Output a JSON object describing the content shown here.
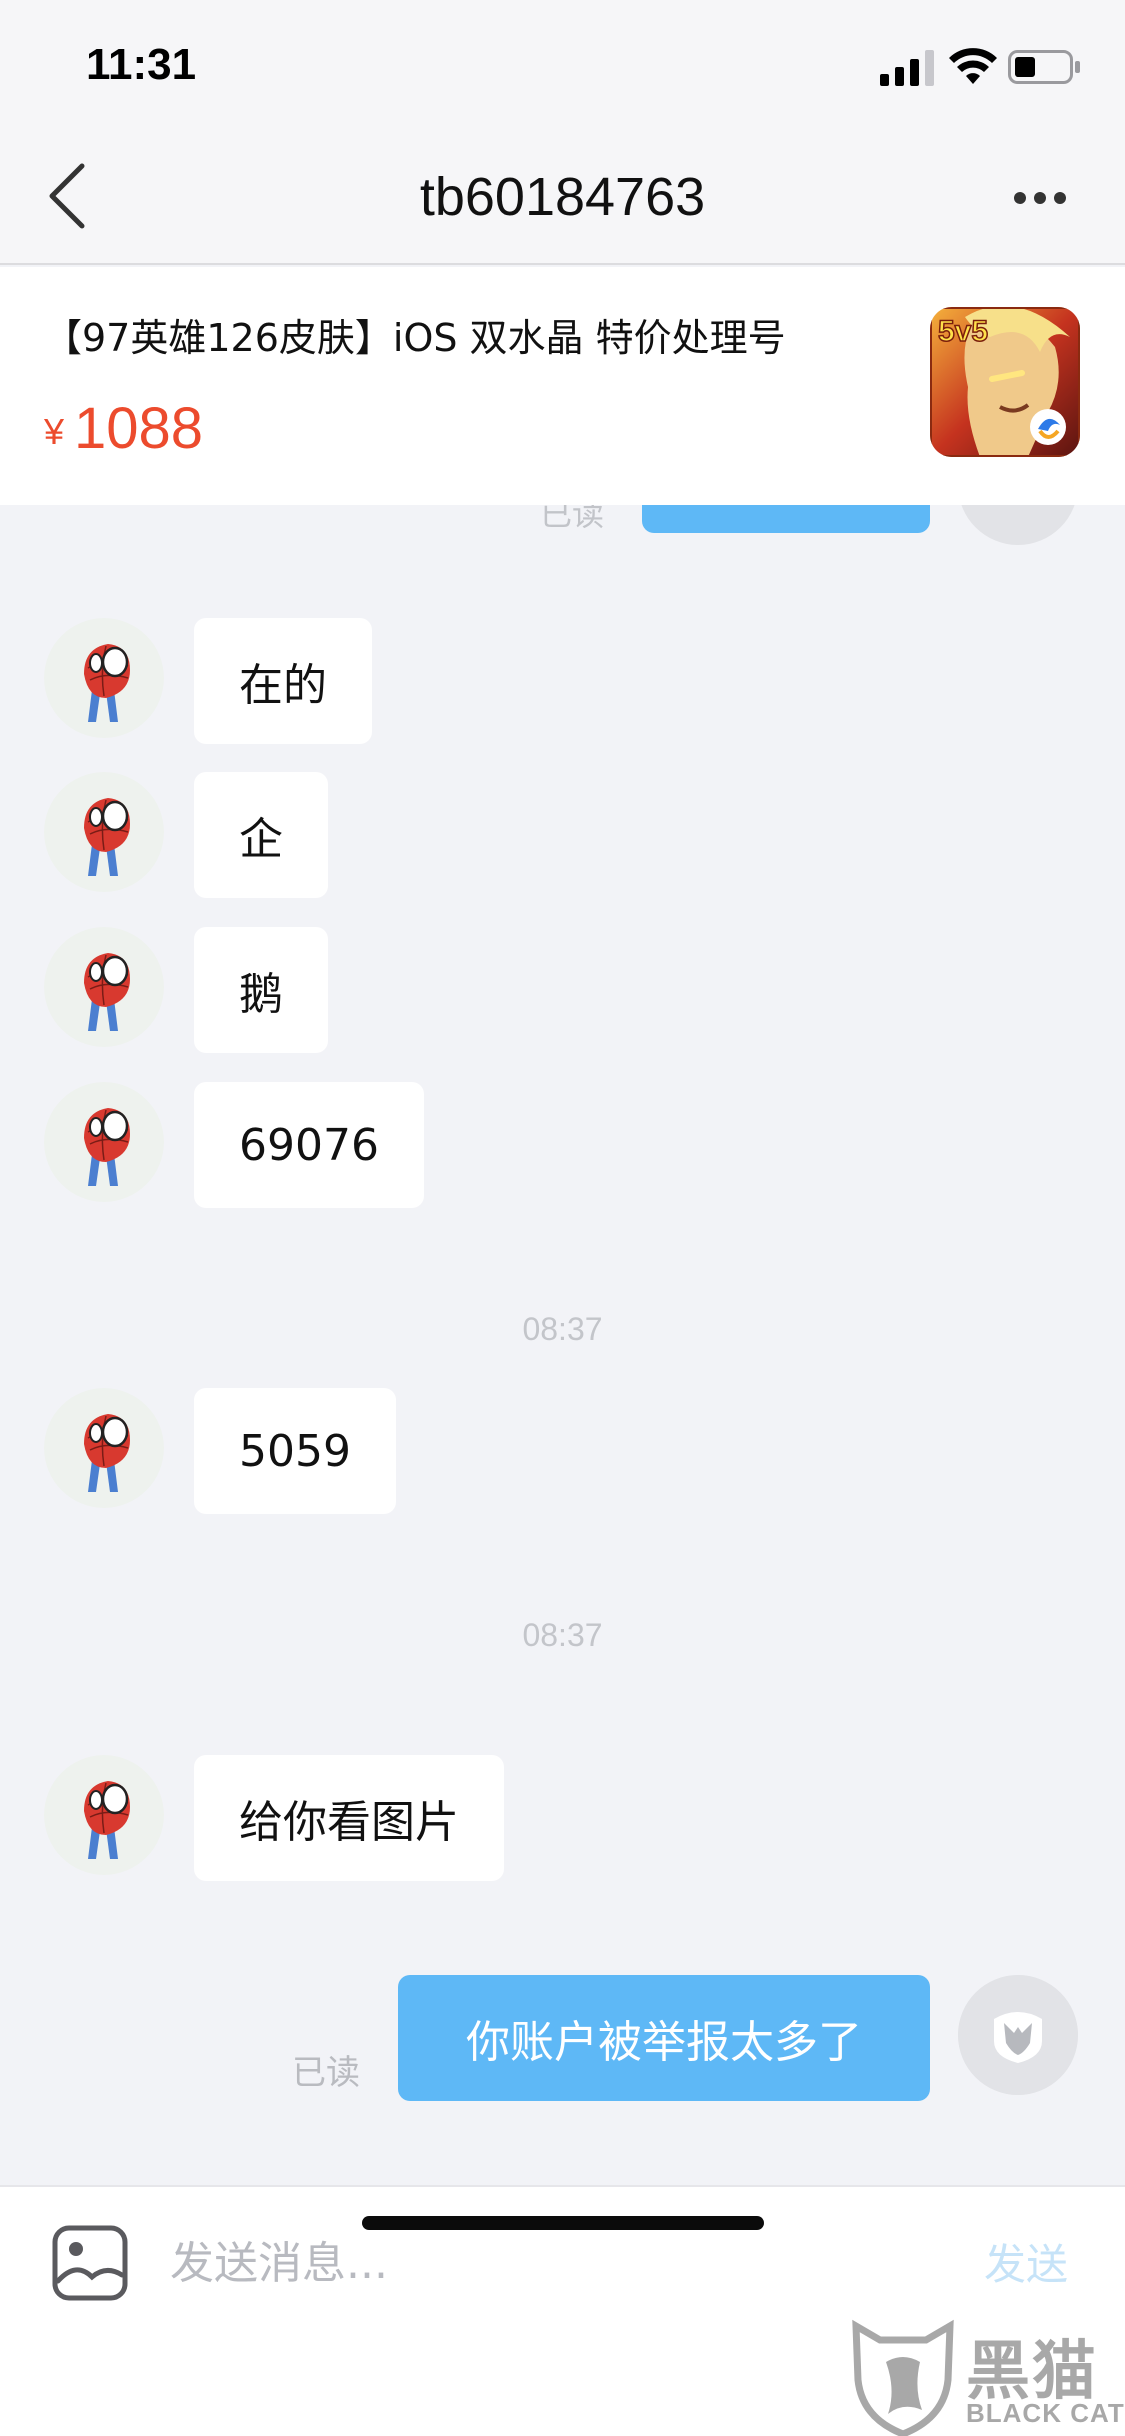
{
  "status_bar": {
    "time": "11:31"
  },
  "nav": {
    "title": "tb60184763"
  },
  "product": {
    "title": "【97英雄126皮肤】iOS 双水晶 特价处理号",
    "currency_symbol": "¥",
    "price": "1088",
    "thumbnail_badge": "5v5"
  },
  "chat": {
    "partial_read_label": "已读",
    "messages_them": [
      {
        "text": "在的"
      },
      {
        "text": "企"
      },
      {
        "text": "鹅"
      },
      {
        "text": "69076"
      },
      {
        "text": "5059"
      },
      {
        "text": "给你看图片"
      }
    ],
    "timestamps": [
      "08:37",
      "08:37"
    ],
    "message_me": {
      "text": "你账户被举报太多了",
      "read_label": "已读"
    }
  },
  "input_bar": {
    "placeholder": "发送消息...",
    "send_label": "发送"
  },
  "watermark": {
    "cn": "黑猫",
    "en": "BLACK CAT"
  },
  "colors": {
    "accent_blue": "#5eb8f6",
    "price_red": "#ec4b2d",
    "chat_background": "#f2f3f7"
  }
}
